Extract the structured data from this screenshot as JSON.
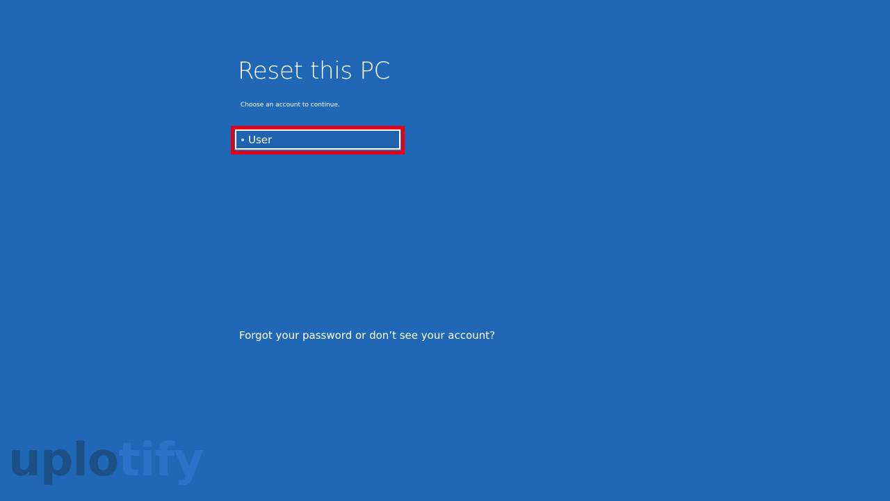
{
  "screen": {
    "title": "Reset this PC",
    "subtitle": "Choose an account to continue.",
    "accounts": [
      {
        "label": "User"
      }
    ],
    "forgot_link": "Forgot your password or don’t see your account?"
  },
  "watermark": {
    "part1": "uplo",
    "part2": "tify"
  },
  "colors": {
    "background": "#2068b6",
    "highlight": "#e50016",
    "text": "#ffffff"
  }
}
